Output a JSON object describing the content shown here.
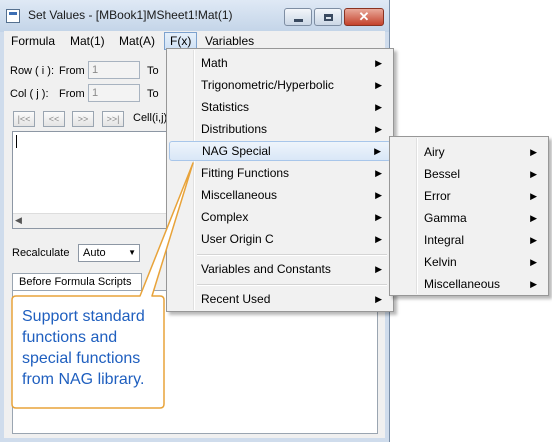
{
  "window": {
    "title": "Set Values - [MBook1]MSheet1!Mat(1)",
    "buttons": {
      "minimize": "minimize",
      "maximize": "maximize",
      "close": "✕"
    }
  },
  "menubar": [
    "Formula",
    "Mat(1)",
    "Mat(A)",
    "F(x)",
    "Variables"
  ],
  "range": {
    "row_label": "Row ( i ):",
    "col_label": "Col  ( j ):",
    "from_label": "From",
    "to_label": "To",
    "row_from": "1",
    "col_from": "1",
    "nav_buttons": [
      "|<<",
      "<<",
      ">>",
      ">>|"
    ],
    "cell_label": "Cell(i,j)"
  },
  "formula": {
    "value": ""
  },
  "recalculate": {
    "label": "Recalculate",
    "value": "Auto"
  },
  "tabs": [
    "Before Formula Scripts"
  ],
  "fx_menu": {
    "items": [
      "Math",
      "Trigonometric/Hyperbolic",
      "Statistics",
      "Distributions",
      "NAG Special",
      "Fitting Functions",
      "Miscellaneous",
      "Complex",
      "User Origin C",
      "Variables and Constants",
      "Recent Used"
    ],
    "highlighted": "NAG Special"
  },
  "nag_submenu": {
    "items": [
      "Airy",
      "Bessel",
      "Error",
      "Gamma",
      "Integral",
      "Kelvin",
      "Miscellaneous"
    ]
  },
  "callout": {
    "text": "Support standard functions and special functions from NAG library."
  },
  "colors": {
    "callout_border": "#e8a33a",
    "callout_text": "#1f5fbf",
    "menu_highlight": "#d9e7f7"
  }
}
